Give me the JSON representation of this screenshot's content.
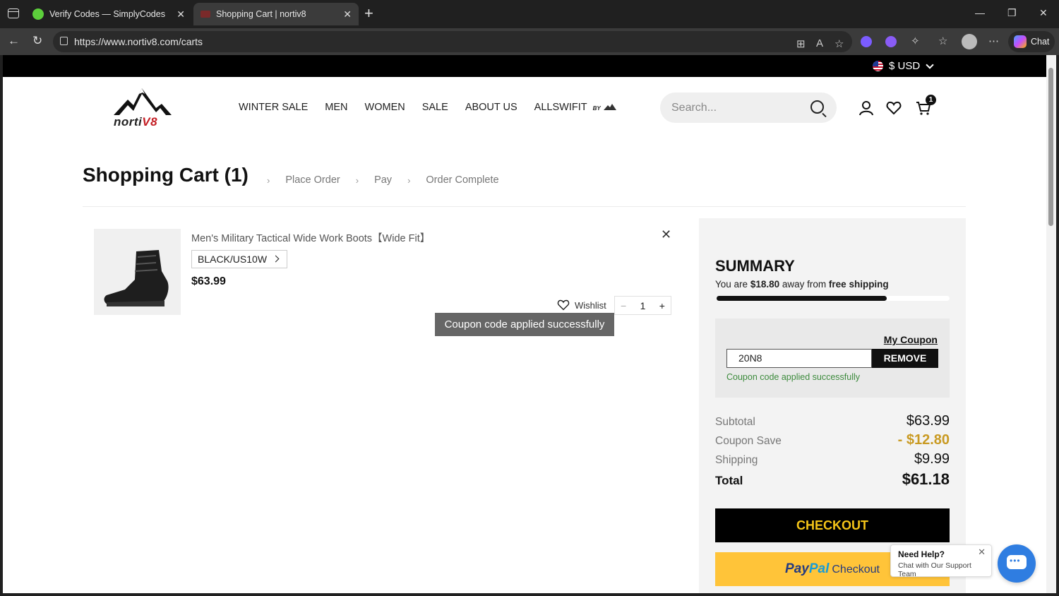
{
  "browser": {
    "tabs": [
      {
        "title": "Verify Codes — SimplyCodes",
        "active": false
      },
      {
        "title": "Shopping Cart | nortiv8",
        "active": true
      }
    ],
    "url": "https://www.nortiv8.com/carts",
    "chat_label": "Chat"
  },
  "topbar": {
    "currency": "$ USD"
  },
  "logo": {
    "name_main": "norti",
    "name_accent": "V8"
  },
  "nav": {
    "items": [
      "WINTER SALE",
      "MEN",
      "WOMEN",
      "SALE",
      "ABOUT US",
      "ALLSWIFIT"
    ],
    "by_tag": "BY"
  },
  "search": {
    "placeholder": "Search..."
  },
  "header": {
    "cart_count": "1"
  },
  "cart": {
    "title": "Shopping Cart (1)",
    "steps": [
      "Place Order",
      "Pay",
      "Order Complete"
    ],
    "item": {
      "name": "Men's Military Tactical Wide Work Boots【Wide Fit】",
      "variant": "BLACK/US10W",
      "price": "$63.99",
      "wishlist_label": "Wishlist",
      "quantity": "1",
      "minus": "−",
      "plus": "+"
    },
    "toast": "Coupon code applied successfully"
  },
  "summary": {
    "title": "SUMMARY",
    "ship_prefix": "You are",
    "ship_amount": "$18.80",
    "ship_mid": "away from",
    "ship_goal": "free shipping",
    "ship_progress": 0.73,
    "my_coupon": "My Coupon",
    "coupon_code": "20N8",
    "remove_label": "REMOVE",
    "coupon_message": "Coupon code applied successfully",
    "subtotal_label": "Subtotal",
    "subtotal": "$63.99",
    "save_label": "Coupon Save",
    "save": "- $12.80",
    "shipping_label": "Shipping",
    "shipping": "$9.99",
    "total_label": "Total",
    "total": "$61.18",
    "checkout_label": "CHECKOUT",
    "paypal_1": "Pay",
    "paypal_2": "Pal",
    "paypal_3": "Checkout"
  },
  "help": {
    "title": "Need Help?",
    "subtitle": "Chat with Our Support Team"
  },
  "colors": {
    "accent_gold": "#c99a22",
    "checkout_text": "#f5c518",
    "paypal": "#ffc439",
    "chat": "#2f7de1"
  }
}
